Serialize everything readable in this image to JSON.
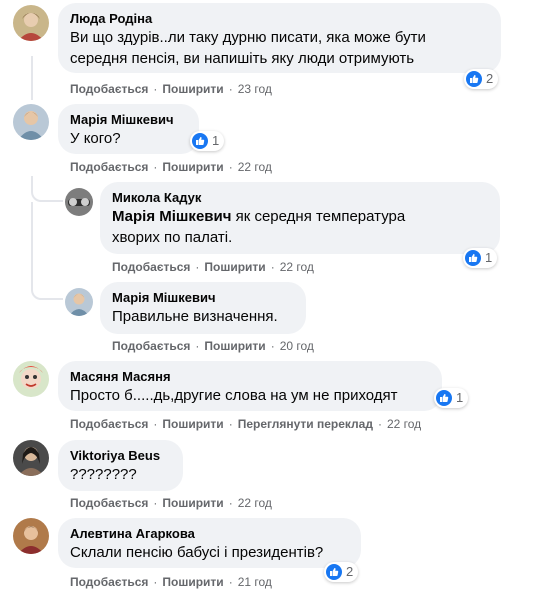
{
  "labels": {
    "like": "Подобається",
    "share": "Поширити",
    "see_translation": "Переглянути переклад",
    "separator": "·"
  },
  "comments": [
    {
      "author": "Люда Родіна",
      "text_lines": [
        "Ви що здурів..ли таку дурню писати, яка може бути",
        "середня пенсія, ви напишіть яку люди отримують"
      ],
      "time": "23 год",
      "reactions": "2"
    },
    {
      "author": "Марія Мішкевич",
      "text_lines": [
        "У кого?"
      ],
      "time": "22 год",
      "reactions": "1"
    },
    {
      "author": "Микола Кадук",
      "mention": "Марія Мішкевич",
      "text_lines": [
        " як середня температура",
        "хворих по палаті."
      ],
      "time": "22 год",
      "reactions": "1"
    },
    {
      "author": "Марія Мішкевич",
      "text_lines": [
        "Правильне визначення."
      ],
      "time": "20 год",
      "reactions": ""
    },
    {
      "author": "Масяня Масяня",
      "text_lines": [
        "Просто б.....дь,другие слова на ум не приходят"
      ],
      "time": "22 год",
      "reactions": "1"
    },
    {
      "author": "Viktoriya Beus",
      "text_lines": [
        "????????"
      ],
      "time": "22 год",
      "reactions": ""
    },
    {
      "author": "Алевтина Агаркова",
      "text_lines": [
        "Склали пенсію бабусі і президентів?"
      ],
      "time": "21 год",
      "reactions": "2"
    }
  ],
  "colors": {
    "bubble": "#f0f2f5",
    "meta_text": "#65676b",
    "like_blue": "#1877f2",
    "thread_line": "#e4e6eb"
  }
}
